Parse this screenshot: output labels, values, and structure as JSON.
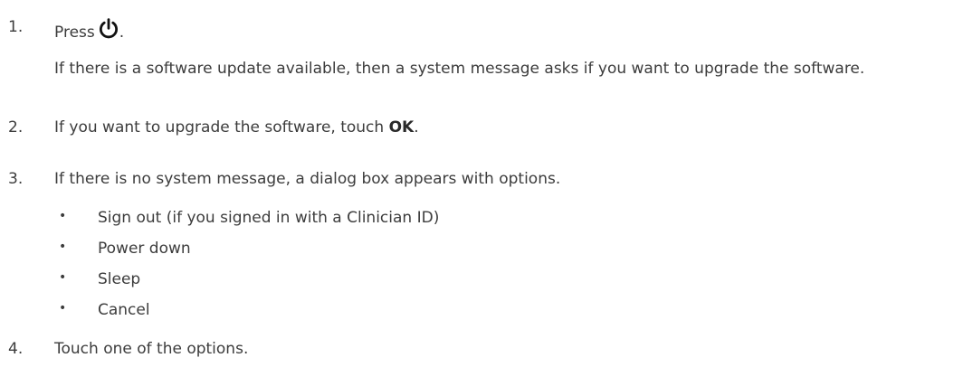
{
  "steps": [
    {
      "number": "1.",
      "text_before": "Press",
      "icon": "power-icon",
      "text_after": ".",
      "note": "If there is a software update available, then a system message asks if you want to upgrade the software."
    },
    {
      "number": "2.",
      "text_before": "If you want to upgrade the software, touch ",
      "bold": "OK",
      "text_after": "."
    },
    {
      "number": "3.",
      "text": "If there is no system message, a dialog box appears with options.",
      "bullet_char": "•",
      "options": [
        "Sign out (if you signed in with a Clinician ID)",
        "Power down",
        "Sleep",
        "Cancel"
      ]
    },
    {
      "number": "4.",
      "text": "Touch one of the options."
    }
  ],
  "colors": {
    "text": "#3c3c3c",
    "background": "#ffffff"
  }
}
